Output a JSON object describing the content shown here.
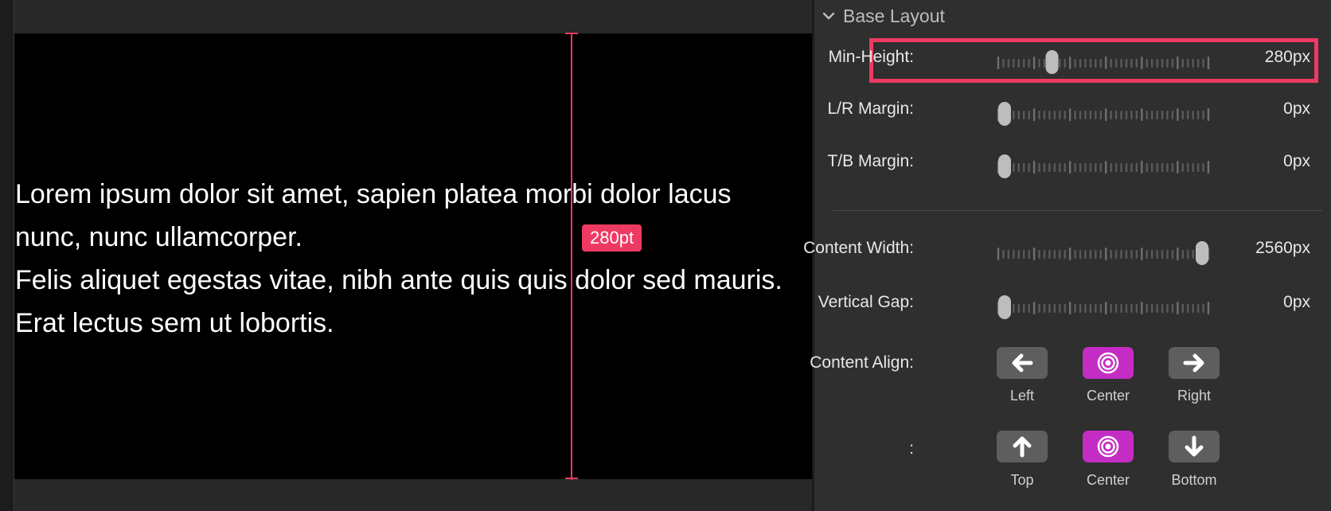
{
  "preview": {
    "paragraph1": "Lorem ipsum dolor sit amet, sapien platea morbi dolor lacus nunc, nunc ullamcorper.",
    "paragraph2": "Felis aliquet egestas vitae, nibh ante quis quis dolor sed mauris. Erat lectus sem ut lobortis.",
    "guide_label": "280pt",
    "guide_color": "#ee3a63"
  },
  "inspector": {
    "section_title": "Base Layout",
    "sliders": [
      {
        "label": "Min-Height:",
        "value": "280px",
        "level": 0.24
      },
      {
        "label": "L/R Margin:",
        "value": "0px",
        "level": 0
      },
      {
        "label": "T/B Margin:",
        "value": "0px",
        "level": 0
      },
      {
        "label": "Content Width:",
        "value": "2560px",
        "level": 1
      },
      {
        "label": "Vertical Gap:",
        "value": "0px",
        "level": 0
      }
    ],
    "content_align": {
      "label": "Content Align:",
      "horizontal": [
        {
          "caption": "Left",
          "icon": "arrow-left-icon",
          "selected": false
        },
        {
          "caption": "Center",
          "icon": "target-icon",
          "selected": true
        },
        {
          "caption": "Right",
          "icon": "arrow-right-icon",
          "selected": false
        }
      ],
      "vertical_label": ":",
      "vertical": [
        {
          "caption": "Top",
          "icon": "arrow-up-icon",
          "selected": false
        },
        {
          "caption": "Center",
          "icon": "target-icon",
          "selected": true
        },
        {
          "caption": "Bottom",
          "icon": "arrow-down-icon",
          "selected": false
        }
      ]
    },
    "accent_color": "#c42dc4",
    "highlight_color": "#ee3a63"
  }
}
